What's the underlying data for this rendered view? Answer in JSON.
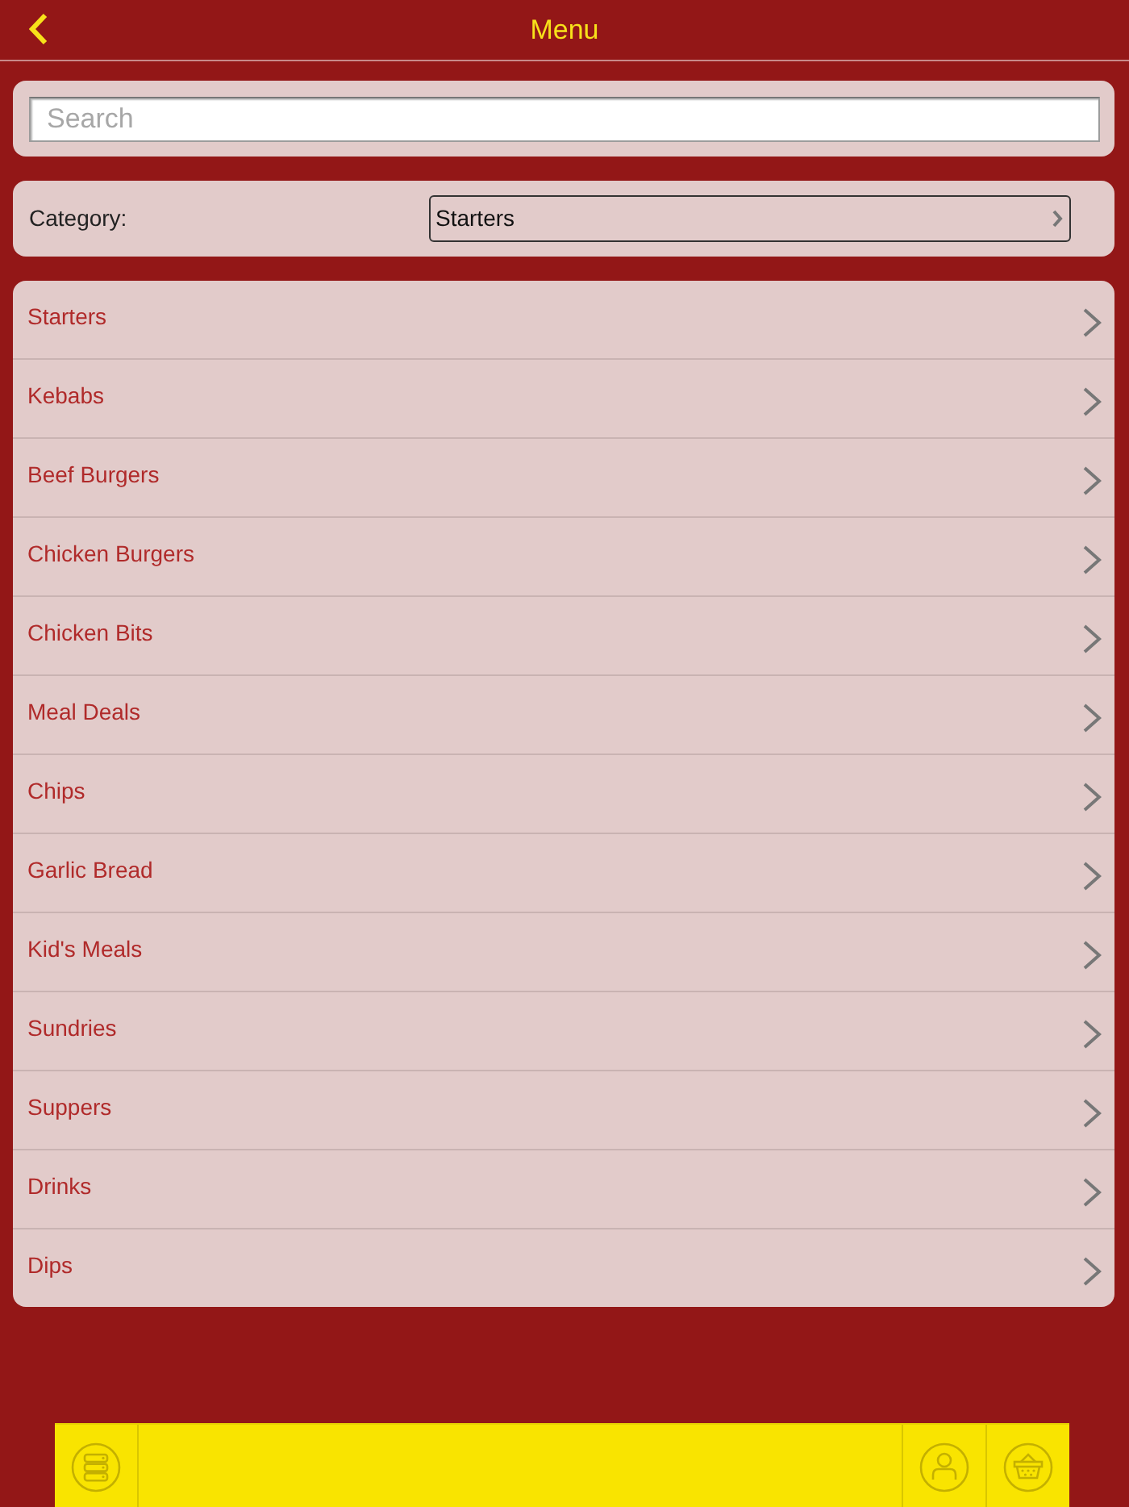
{
  "header": {
    "title": "Menu"
  },
  "search": {
    "placeholder": "Search"
  },
  "category": {
    "label": "Category:",
    "value": "Starters"
  },
  "items": [
    {
      "label": "Starters"
    },
    {
      "label": "Kebabs"
    },
    {
      "label": "Beef Burgers"
    },
    {
      "label": "Chicken Burgers"
    },
    {
      "label": "Chicken Bits"
    },
    {
      "label": "Meal Deals"
    },
    {
      "label": "Chips"
    },
    {
      "label": "Garlic Bread"
    },
    {
      "label": "Kid's Meals"
    },
    {
      "label": "Sundries"
    },
    {
      "label": "Suppers"
    },
    {
      "label": "Drinks"
    },
    {
      "label": "Dips"
    }
  ]
}
